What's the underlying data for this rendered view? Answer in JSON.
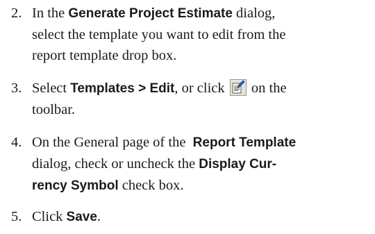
{
  "steps": [
    {
      "number": "2.",
      "lines": [
        [
          "In the ",
          "Generate Project Estimate",
          " dialog,"
        ],
        [
          "select the template you want to edit from the"
        ],
        [
          "report template drop box."
        ]
      ]
    },
    {
      "number": "3.",
      "lines": [
        [
          "Select ",
          "Templates > Edit",
          ", or click ",
          " on the"
        ],
        [
          "toolbar."
        ]
      ],
      "icon": "edit-template-icon"
    },
    {
      "number": "4.",
      "lines": [
        [
          "On the General page of the  ",
          "Report Template"
        ],
        [
          "dialog, check or uncheck the ",
          "Display Cur-"
        ],
        [
          "rency Symbol",
          " check box."
        ]
      ]
    },
    {
      "number": "5.",
      "lines": [
        [
          "Click ",
          "Save",
          "."
        ]
      ]
    }
  ]
}
